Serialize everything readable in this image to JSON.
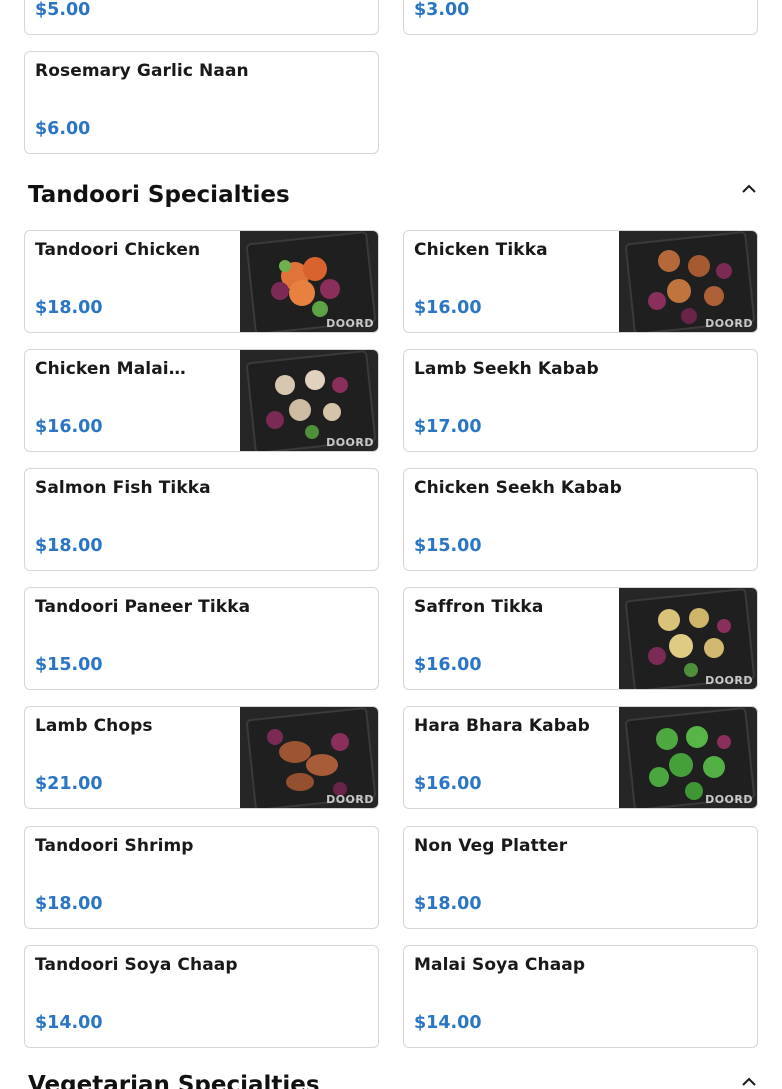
{
  "top_partial": {
    "left_price": "$5.00",
    "right_price": "$3.00"
  },
  "bread_items": [
    {
      "name": "Rosemary Garlic Naan",
      "price": "$6.00"
    }
  ],
  "tandoori": {
    "title": "Tandoori Specialties",
    "items": [
      {
        "name": "Tandoori Chicken",
        "price": "$18.00",
        "image_watermark": "DOORD"
      },
      {
        "name": "Chicken Tikka",
        "price": "$16.00",
        "image_watermark": "DOORD"
      },
      {
        "name": "Chicken Malai…",
        "price": "$16.00",
        "image_watermark": "DOORD"
      },
      {
        "name": "Lamb Seekh Kabab",
        "price": "$17.00"
      },
      {
        "name": "Salmon Fish Tikka",
        "price": "$18.00"
      },
      {
        "name": "Chicken Seekh Kabab",
        "price": "$15.00"
      },
      {
        "name": "Tandoori Paneer Tikka",
        "price": "$15.00"
      },
      {
        "name": "Saffron Tikka",
        "price": "$16.00",
        "image_watermark": "DOORD"
      },
      {
        "name": "Lamb Chops",
        "price": "$21.00",
        "image_watermark": "DOORD"
      },
      {
        "name": "Hara Bhara Kabab",
        "price": "$16.00",
        "image_watermark": "DOORD"
      },
      {
        "name": "Tandoori Shrimp",
        "price": "$18.00"
      },
      {
        "name": "Non Veg Platter",
        "price": "$18.00"
      },
      {
        "name": "Tandoori Soya Chaap",
        "price": "$14.00"
      },
      {
        "name": "Malai Soya Chaap",
        "price": "$14.00"
      }
    ]
  },
  "vegetarian": {
    "title": "Vegetarian Specialties"
  },
  "colors": {
    "price": "#2a76c4",
    "card_border": "#d6d6d6",
    "title": "#111111"
  },
  "icons": {
    "collapse": "chevron-up-icon"
  }
}
